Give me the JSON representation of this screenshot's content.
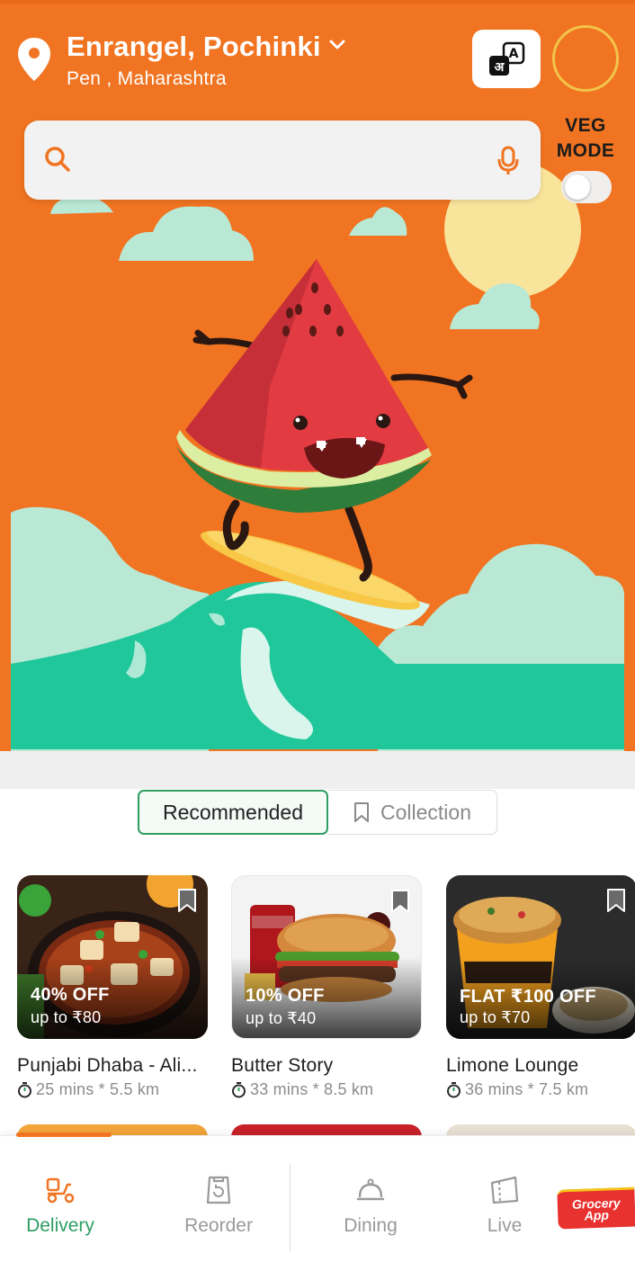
{
  "header": {
    "location_title": "Enrangel, Pochinki",
    "location_subtitle": "Pen , Maharashtra",
    "language_button_glyphs": {
      "hindi": "अ",
      "latin": "A"
    }
  },
  "search": {
    "placeholder": ""
  },
  "veg_mode": {
    "label_line1": "VEG",
    "label_line2": "MODE",
    "enabled": false
  },
  "tabs": [
    {
      "label": "Recommended",
      "active": true
    },
    {
      "label": "Collection",
      "active": false
    }
  ],
  "restaurants": [
    {
      "name": "Punjabi Dhaba - Ali...",
      "offer": "40% OFF",
      "offer_sub": "up to ₹80",
      "meta": "25 mins * 5.5 km"
    },
    {
      "name": "Butter Story",
      "offer": "10% OFF",
      "offer_sub": "up to ₹40",
      "meta": "33 mins * 8.5 km"
    },
    {
      "name": "Limone Lounge",
      "offer": "FLAT ₹100 OFF",
      "offer_sub": "up to ₹70",
      "meta": "36 mins * 7.5 km"
    }
  ],
  "bottom_nav": [
    {
      "label": "Delivery",
      "icon": "scooter-icon",
      "active": true
    },
    {
      "label": "Reorder",
      "icon": "reorder-bag-icon",
      "active": false
    },
    {
      "label": "Dining",
      "icon": "cloche-icon",
      "active": false
    },
    {
      "label": "Live",
      "icon": "ticket-icon",
      "active": false
    }
  ],
  "grocery_badge": {
    "line1": "Grocery",
    "line2": "App"
  },
  "colors": {
    "brand_orange": "#F07421",
    "active_green": "#2e9e63",
    "grocery_red": "#e8322f"
  }
}
